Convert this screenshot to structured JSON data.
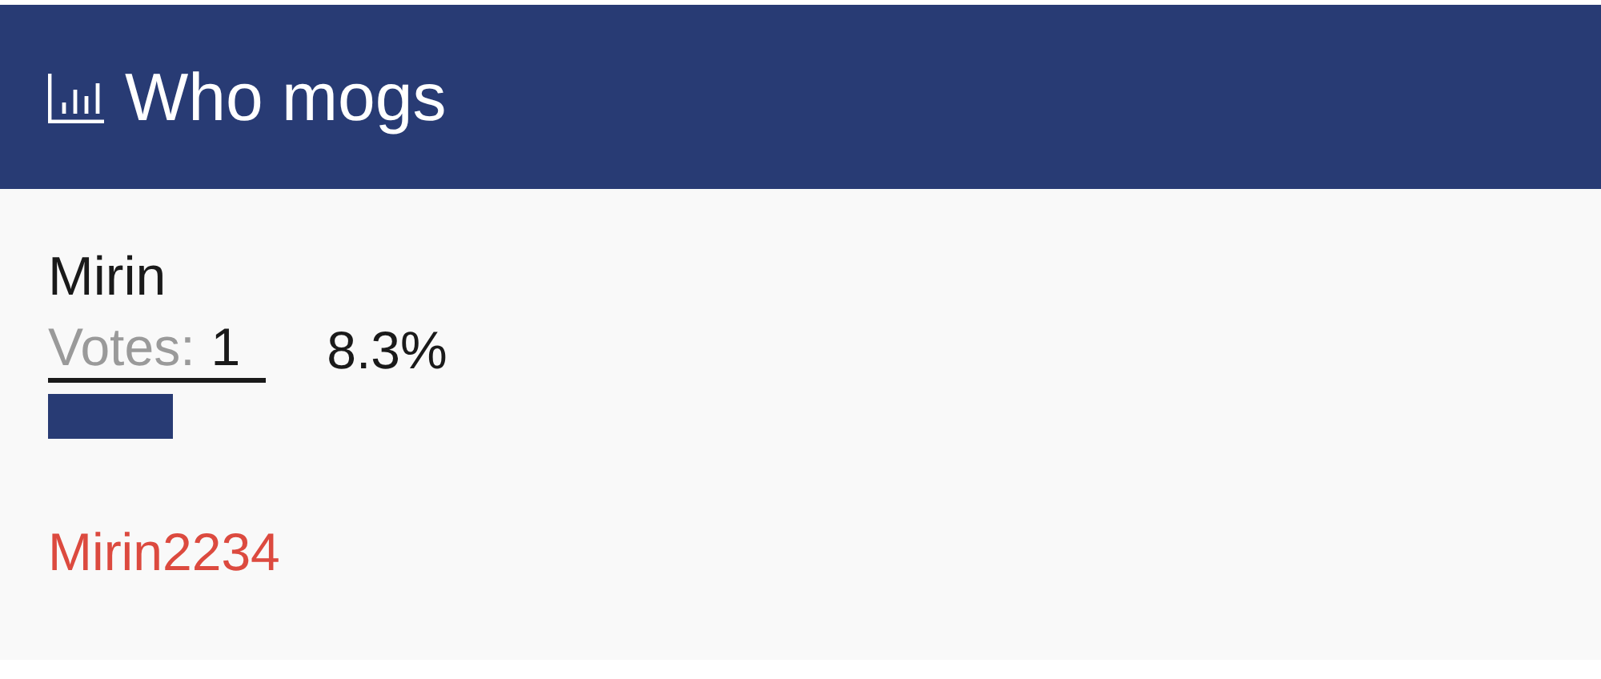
{
  "header": {
    "title": "Who mogs"
  },
  "options": [
    {
      "name": "Mirin",
      "votes_label": "Votes:",
      "votes": "1",
      "percent": "8.3%",
      "level": 0.083
    }
  ],
  "footer_link": "Mirin2234"
}
